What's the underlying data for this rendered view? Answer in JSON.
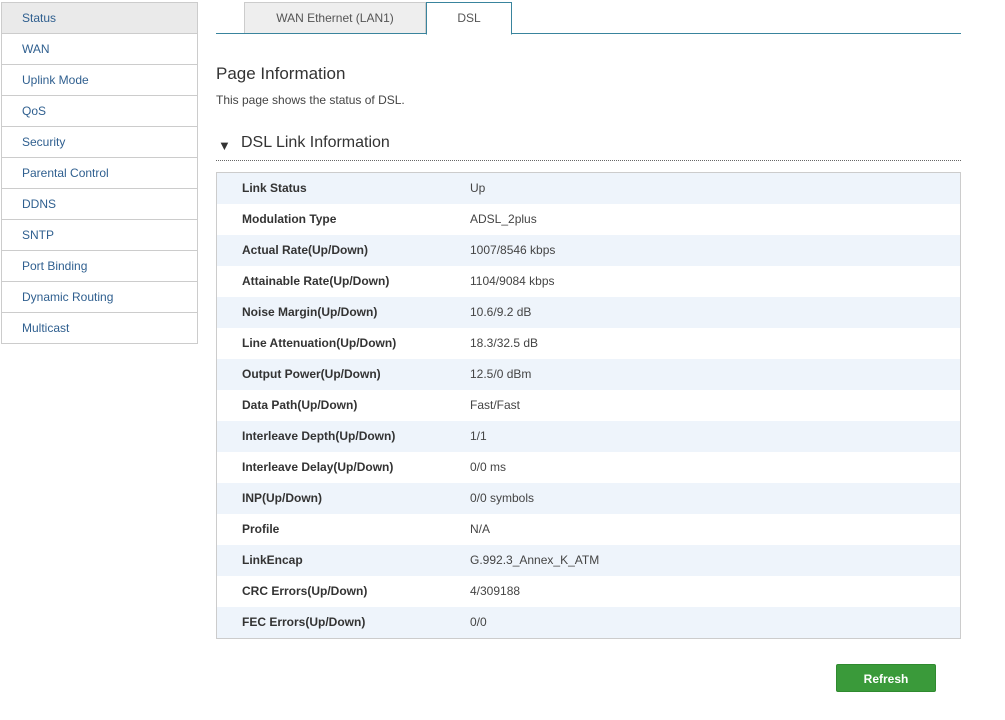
{
  "sidebar": {
    "items": [
      {
        "label": "Status",
        "active": true
      },
      {
        "label": "WAN"
      },
      {
        "label": "Uplink Mode"
      },
      {
        "label": "QoS"
      },
      {
        "label": "Security"
      },
      {
        "label": "Parental Control"
      },
      {
        "label": "DDNS"
      },
      {
        "label": "SNTP"
      },
      {
        "label": "Port Binding"
      },
      {
        "label": "Dynamic Routing"
      },
      {
        "label": "Multicast"
      }
    ]
  },
  "tabs": [
    {
      "label": "WAN Ethernet (LAN1)"
    },
    {
      "label": "DSL",
      "active": true
    }
  ],
  "page": {
    "title": "Page Information",
    "description": "This page shows the status of DSL."
  },
  "section": {
    "arrow": "▼",
    "title": "DSL Link Information"
  },
  "rows": [
    {
      "label": "Link Status",
      "value": "Up"
    },
    {
      "label": "Modulation Type",
      "value": "ADSL_2plus"
    },
    {
      "label": "Actual Rate(Up/Down)",
      "value": "1007/8546 kbps"
    },
    {
      "label": "Attainable Rate(Up/Down)",
      "value": "1104/9084 kbps"
    },
    {
      "label": "Noise Margin(Up/Down)",
      "value": "10.6/9.2 dB"
    },
    {
      "label": "Line Attenuation(Up/Down)",
      "value": "18.3/32.5 dB"
    },
    {
      "label": "Output Power(Up/Down)",
      "value": "12.5/0 dBm"
    },
    {
      "label": "Data Path(Up/Down)",
      "value": "Fast/Fast"
    },
    {
      "label": "Interleave Depth(Up/Down)",
      "value": "1/1"
    },
    {
      "label": "Interleave Delay(Up/Down)",
      "value": "0/0 ms"
    },
    {
      "label": "INP(Up/Down)",
      "value": "0/0 symbols"
    },
    {
      "label": "Profile",
      "value": "N/A"
    },
    {
      "label": "LinkEncap",
      "value": "G.992.3_Annex_K_ATM"
    },
    {
      "label": "CRC Errors(Up/Down)",
      "value": "4/309188"
    },
    {
      "label": "FEC Errors(Up/Down)",
      "value": "0/0"
    }
  ],
  "actions": {
    "refresh_label": "Refresh"
  },
  "colors": {
    "accent": "#39849d",
    "link": "#2f5f8f",
    "button": "#3a9a3a",
    "row_alt": "#eef4fb"
  }
}
